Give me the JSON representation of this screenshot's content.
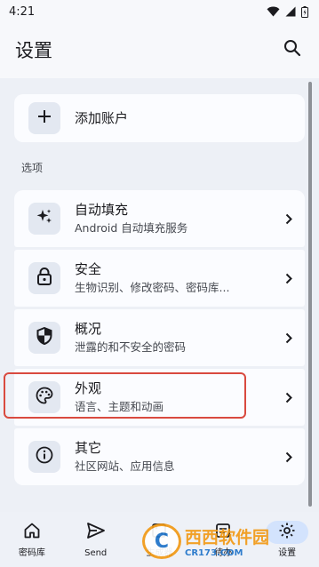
{
  "status_bar": {
    "time": "4:21",
    "icons": [
      "wifi-icon",
      "signal-icon",
      "battery-icon"
    ]
  },
  "app_bar": {
    "title": "设置",
    "search_icon": "search-icon"
  },
  "add_account": {
    "icon": "plus-icon",
    "label": "添加账户"
  },
  "section_label": "选项",
  "settings_items": [
    {
      "icon": "sparkle-icon",
      "title": "自动填充",
      "subtitle": "Android 自动填充服务"
    },
    {
      "icon": "lock-icon",
      "title": "安全",
      "subtitle": "生物识别、修改密码、密码库..."
    },
    {
      "icon": "shield-icon",
      "title": "概况",
      "subtitle": "泄露的和不安全的密码"
    },
    {
      "icon": "palette-icon",
      "title": "外观",
      "subtitle": "语言、主题和动画"
    },
    {
      "icon": "info-icon",
      "title": "其它",
      "subtitle": "社区网站、应用信息"
    }
  ],
  "bottom_nav": [
    {
      "icon": "home-icon",
      "label": "密码库"
    },
    {
      "icon": "send-icon",
      "label": "Send"
    },
    {
      "icon": "generator-icon",
      "label": "生成器"
    },
    {
      "icon": "inbox-icon",
      "label": "待办"
    },
    {
      "icon": "gear-icon",
      "label": "设置"
    }
  ],
  "watermark": {
    "badge": "C",
    "title": "西西软件园",
    "url": "CR173.COM"
  },
  "colors": {
    "background": "#f7f8fb",
    "content_bg": "#edf0f6",
    "card_bg": "#fbfcff",
    "icon_bg": "#e3e8f1",
    "highlight": "#d94a3f",
    "nav_active": "#d3e3fd"
  }
}
